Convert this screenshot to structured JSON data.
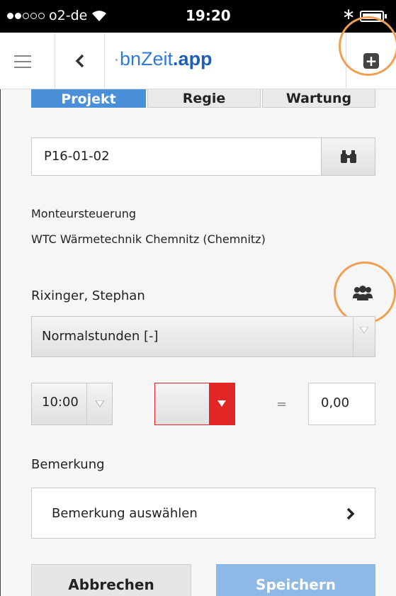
{
  "status_bar": {
    "carrier": "o2-de",
    "time": "19:20"
  },
  "nav": {
    "logo_part1": "bnZe",
    "logo_part2": "it",
    "logo_suffix": ".app"
  },
  "segments": [
    {
      "label": "Projekt"
    },
    {
      "label": "Regie"
    },
    {
      "label": "Wartung"
    }
  ],
  "project": {
    "value": "P16-01-02"
  },
  "info": {
    "line1": "Monteursteuerung",
    "line2": "WTC Wärmetechnik Chemnitz (Chemnitz)"
  },
  "employee": {
    "name": "Rixinger, Stephan"
  },
  "hour_type": {
    "selected": "Normalstunden [-]"
  },
  "time": {
    "value": "10:00",
    "equals": "=",
    "result": "0,00"
  },
  "remark": {
    "label": "Bemerkung",
    "placeholder": "Bemerkung auswählen"
  },
  "actions": {
    "cancel": "Abbrechen",
    "save": "Speichern"
  },
  "colors": {
    "accent": "#4a90d9",
    "save": "#8eb8e6",
    "highlight": "#f0a050",
    "alert": "#e22525"
  }
}
